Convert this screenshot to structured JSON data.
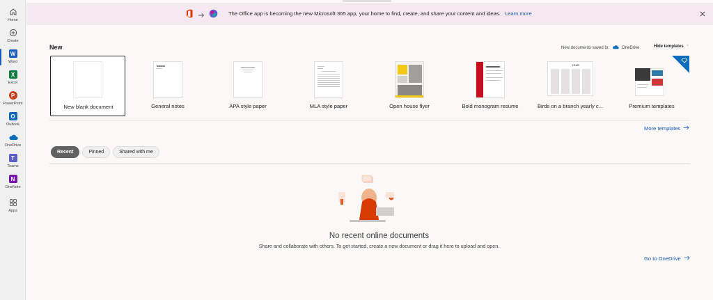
{
  "rail": {
    "items": [
      {
        "label": "Home",
        "icon": "home-icon"
      },
      {
        "label": "Create",
        "icon": "create-icon"
      },
      {
        "label": "Word",
        "icon": "word-icon",
        "letter": "W",
        "color": "#185abd"
      },
      {
        "label": "Excel",
        "icon": "excel-icon",
        "letter": "X",
        "color": "#107c41"
      },
      {
        "label": "PowerPoint",
        "icon": "powerpoint-icon",
        "letter": "P",
        "color": "#c43e1c"
      },
      {
        "label": "Outlook",
        "icon": "outlook-icon",
        "letter": "O",
        "color": "#0f6cbd"
      },
      {
        "label": "OneDrive",
        "icon": "onedrive-icon"
      },
      {
        "label": "Teams",
        "icon": "teams-icon",
        "letter": "T",
        "color": "#5b5fc7"
      },
      {
        "label": "OneNote",
        "icon": "onenote-icon",
        "letter": "N",
        "color": "#7719aa"
      },
      {
        "label": "Apps",
        "icon": "apps-icon"
      }
    ]
  },
  "banner": {
    "text": "The Office app is becoming the new Microsoft 365 app, your home to find, create, and share your content and ideas.",
    "link": "Learn more"
  },
  "new_section": {
    "title": "New",
    "saved_to_label": "New documents saved to:",
    "saved_to_location": "OneDrive",
    "hide_templates": "Hide templates",
    "templates": [
      {
        "label": "New blank document"
      },
      {
        "label": "General notes"
      },
      {
        "label": "APA style paper"
      },
      {
        "label": "MLA style paper"
      },
      {
        "label": "Open house flyer"
      },
      {
        "label": "Bold monogram resume"
      },
      {
        "label": "Birds on a branch yearly c..."
      },
      {
        "label": "Premium templates"
      }
    ],
    "more_templates": "More templates"
  },
  "tabs": [
    {
      "label": "Recent",
      "active": true
    },
    {
      "label": "Pinned",
      "active": false
    },
    {
      "label": "Shared with me",
      "active": false
    }
  ],
  "empty_state": {
    "title": "No recent online documents",
    "description": "Share and collaborate with others. To get started, create a new document or drag it here to upload and open.",
    "link": "Go to OneDrive"
  },
  "colors": {
    "accent": "#185abd",
    "banner_bg": "#f6e8ef"
  }
}
